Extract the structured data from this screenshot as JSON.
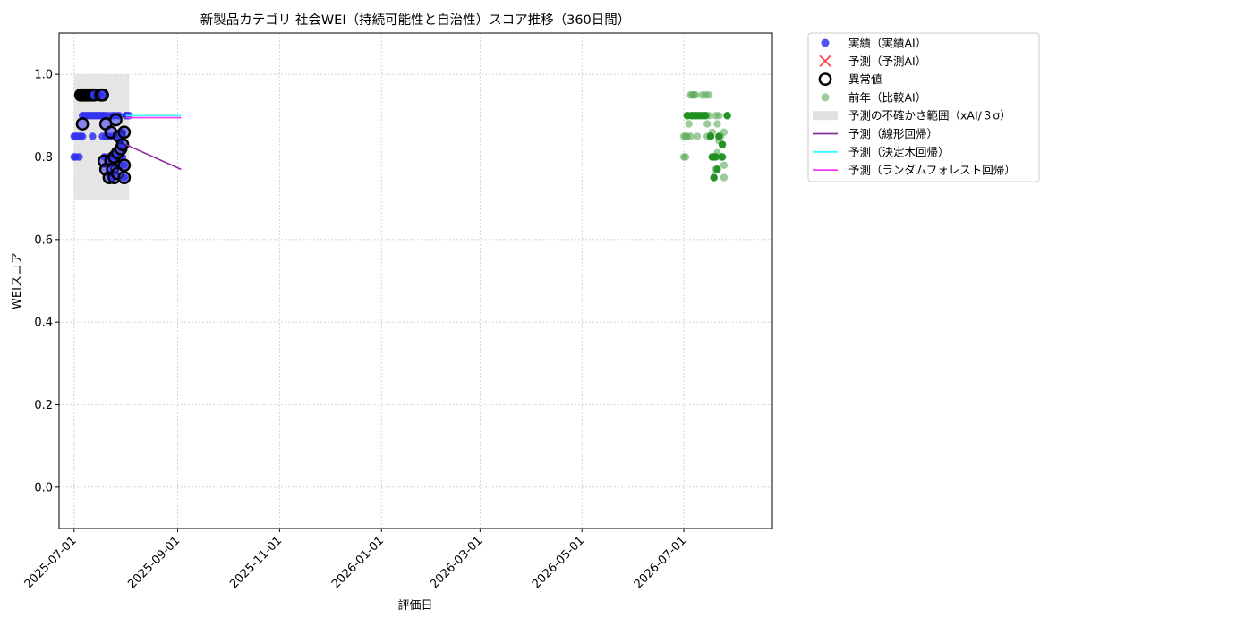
{
  "chart_data": {
    "type": "scatter",
    "title": "新製品カテゴリ 社会WEI（持続可能性と自治性）スコア推移（360日間）",
    "xlabel": "評価日",
    "ylabel": "WEIスコア",
    "ylim": [
      -0.1,
      1.1
    ],
    "y_ticks": [
      0.0,
      0.2,
      0.4,
      0.6,
      0.8,
      1.0
    ],
    "y_tick_labels": [
      "0.0",
      "0.2",
      "0.4",
      "0.6",
      "0.8",
      "1.0"
    ],
    "xlim": [
      "2025-06-22",
      "2026-08-23"
    ],
    "x_ticks": [
      "2025-07-01",
      "2025-09-01",
      "2025-11-01",
      "2026-01-01",
      "2026-03-01",
      "2026-05-01",
      "2026-07-01"
    ],
    "grid": true,
    "legend_position": "outside-top-right",
    "legend": [
      {
        "label": "実績（実績AI）",
        "marker": "dot",
        "color": "#3333ee"
      },
      {
        "label": "予測（予測AI）",
        "marker": "x",
        "color": "#ff4444"
      },
      {
        "label": "異常値",
        "marker": "ring",
        "color": "#000000"
      },
      {
        "label": "前年（比較AI）",
        "marker": "dot-light",
        "color": "#5aaa5a"
      },
      {
        "label": "予測の不確かさ範囲（xAI/３σ）",
        "marker": "band",
        "color": "#e0e0e0"
      },
      {
        "label": "予測（線形回帰）",
        "marker": "line",
        "color": "#8b2b9b"
      },
      {
        "label": "予測（決定木回帰）",
        "marker": "line",
        "color": "#33ffff"
      },
      {
        "label": "予測（ランダムフォレスト回帰）",
        "marker": "line",
        "color": "#ff33ff"
      }
    ],
    "series": [
      {
        "name": "実績（実績AI）",
        "color": "#3333ee",
        "points": [
          [
            "2025-07-01",
            0.85
          ],
          [
            "2025-07-01",
            0.8
          ],
          [
            "2025-07-02",
            0.85
          ],
          [
            "2025-07-02",
            0.8
          ],
          [
            "2025-07-03",
            0.85
          ],
          [
            "2025-07-04",
            0.85
          ],
          [
            "2025-07-04",
            0.8
          ],
          [
            "2025-07-05",
            0.85
          ],
          [
            "2025-07-06",
            0.85
          ],
          [
            "2025-07-06",
            0.9
          ],
          [
            "2025-07-07",
            0.9
          ],
          [
            "2025-07-07",
            0.95
          ],
          [
            "2025-07-08",
            0.9
          ],
          [
            "2025-07-08",
            0.95
          ],
          [
            "2025-07-09",
            0.9
          ],
          [
            "2025-07-09",
            0.95
          ],
          [
            "2025-07-10",
            0.9
          ],
          [
            "2025-07-10",
            0.95
          ],
          [
            "2025-07-11",
            0.9
          ],
          [
            "2025-07-11",
            0.95
          ],
          [
            "2025-07-12",
            0.85
          ],
          [
            "2025-07-12",
            0.9
          ],
          [
            "2025-07-13",
            0.9
          ],
          [
            "2025-07-13",
            0.95
          ],
          [
            "2025-07-14",
            0.9
          ],
          [
            "2025-07-14",
            0.95
          ],
          [
            "2025-07-15",
            0.9
          ],
          [
            "2025-07-15",
            0.95
          ],
          [
            "2025-07-16",
            0.9
          ],
          [
            "2025-07-16",
            0.95
          ],
          [
            "2025-07-17",
            0.9
          ],
          [
            "2025-07-17",
            0.95
          ],
          [
            "2025-07-18",
            0.9
          ],
          [
            "2025-07-18",
            0.85
          ],
          [
            "2025-07-19",
            0.9
          ],
          [
            "2025-07-19",
            0.8
          ],
          [
            "2025-07-20",
            0.9
          ],
          [
            "2025-07-20",
            0.85
          ],
          [
            "2025-07-21",
            0.85
          ],
          [
            "2025-07-21",
            0.8
          ],
          [
            "2025-07-22",
            0.85
          ],
          [
            "2025-07-22",
            0.9
          ],
          [
            "2025-07-23",
            0.8
          ],
          [
            "2025-07-23",
            0.75
          ],
          [
            "2025-07-24",
            0.85
          ],
          [
            "2025-07-24",
            0.9
          ],
          [
            "2025-07-25",
            0.8
          ],
          [
            "2025-07-25",
            0.9
          ],
          [
            "2025-07-26",
            0.85
          ],
          [
            "2025-07-26",
            0.78
          ],
          [
            "2025-07-27",
            0.9
          ],
          [
            "2025-07-27",
            0.8
          ],
          [
            "2025-07-28",
            0.9
          ],
          [
            "2025-07-28",
            0.85
          ],
          [
            "2025-07-29",
            0.83
          ],
          [
            "2025-07-29",
            0.78
          ],
          [
            "2025-07-30",
            0.8
          ],
          [
            "2025-07-30",
            0.86
          ],
          [
            "2025-07-31",
            0.75
          ],
          [
            "2025-07-31",
            0.78
          ],
          [
            "2025-08-01",
            0.9
          ],
          [
            "2025-08-01",
            0.9
          ],
          [
            "2025-08-02",
            0.9
          ],
          [
            "2025-08-03",
            0.9
          ]
        ]
      },
      {
        "name": "異常値",
        "color": "#000000",
        "points": [
          [
            "2025-07-05",
            0.95
          ],
          [
            "2025-07-06",
            0.95
          ],
          [
            "2025-07-07",
            0.95
          ],
          [
            "2025-07-08",
            0.95
          ],
          [
            "2025-07-09",
            0.95
          ],
          [
            "2025-07-10",
            0.95
          ],
          [
            "2025-07-11",
            0.95
          ],
          [
            "2025-07-12",
            0.95
          ],
          [
            "2025-07-13",
            0.95
          ],
          [
            "2025-07-17",
            0.95
          ],
          [
            "2025-07-18",
            0.95
          ],
          [
            "2025-07-06",
            0.88
          ],
          [
            "2025-07-20",
            0.88
          ],
          [
            "2025-07-19",
            0.79
          ],
          [
            "2025-07-20",
            0.77
          ],
          [
            "2025-07-22",
            0.75
          ],
          [
            "2025-07-23",
            0.79
          ],
          [
            "2025-07-23",
            0.86
          ],
          [
            "2025-07-24",
            0.77
          ],
          [
            "2025-07-25",
            0.8
          ],
          [
            "2025-07-25",
            0.75
          ],
          [
            "2025-07-26",
            0.89
          ],
          [
            "2025-07-27",
            0.81
          ],
          [
            "2025-07-27",
            0.76
          ],
          [
            "2025-07-28",
            0.85
          ],
          [
            "2025-07-29",
            0.82
          ],
          [
            "2025-07-30",
            0.83
          ],
          [
            "2025-07-31",
            0.86
          ],
          [
            "2025-07-31",
            0.78
          ],
          [
            "2025-07-31",
            0.75
          ]
        ]
      },
      {
        "name": "前年（比較AI）",
        "color": "#5aaa5a",
        "points": [
          [
            "2026-07-01",
            0.85
          ],
          [
            "2026-07-01",
            0.8
          ],
          [
            "2026-07-02",
            0.85
          ],
          [
            "2026-07-02",
            0.8
          ],
          [
            "2026-07-03",
            0.85
          ],
          [
            "2026-07-03",
            0.9
          ],
          [
            "2026-07-04",
            0.9
          ],
          [
            "2026-07-04",
            0.88
          ],
          [
            "2026-07-05",
            0.9
          ],
          [
            "2026-07-05",
            0.85
          ],
          [
            "2026-07-05",
            0.95
          ],
          [
            "2026-07-06",
            0.95
          ],
          [
            "2026-07-06",
            0.9
          ],
          [
            "2026-07-07",
            0.95
          ],
          [
            "2026-07-07",
            0.9
          ],
          [
            "2026-07-08",
            0.95
          ],
          [
            "2026-07-08",
            0.9
          ],
          [
            "2026-07-09",
            0.85
          ],
          [
            "2026-07-09",
            0.9
          ],
          [
            "2026-07-10",
            0.9
          ],
          [
            "2026-07-11",
            0.9
          ],
          [
            "2026-07-12",
            0.95
          ],
          [
            "2026-07-13",
            0.9
          ],
          [
            "2026-07-14",
            0.95
          ],
          [
            "2026-07-14",
            0.9
          ],
          [
            "2026-07-15",
            0.88
          ],
          [
            "2026-07-15",
            0.85
          ],
          [
            "2026-07-16",
            0.95
          ],
          [
            "2026-07-16",
            0.9
          ],
          [
            "2026-07-17",
            0.85
          ],
          [
            "2026-07-18",
            0.86
          ],
          [
            "2026-07-18",
            0.8
          ],
          [
            "2026-07-19",
            0.8
          ],
          [
            "2026-07-19",
            0.75
          ],
          [
            "2026-07-20",
            0.9
          ],
          [
            "2026-07-20",
            0.77
          ],
          [
            "2026-07-21",
            0.88
          ],
          [
            "2026-07-21",
            0.81
          ],
          [
            "2026-07-22",
            0.84
          ],
          [
            "2026-07-22",
            0.9
          ],
          [
            "2026-07-23",
            0.85
          ],
          [
            "2026-07-23",
            0.8
          ],
          [
            "2026-07-24",
            0.83
          ],
          [
            "2026-07-25",
            0.86
          ],
          [
            "2026-07-25",
            0.78
          ],
          [
            "2026-07-25",
            0.75
          ],
          [
            "2026-07-27",
            0.9
          ]
        ]
      },
      {
        "name": "前年（比較AI） – 濃色点",
        "color": "#1f8f1f",
        "points": [
          [
            "2026-07-03",
            0.9
          ],
          [
            "2026-07-06",
            0.9
          ],
          [
            "2026-07-08",
            0.9
          ],
          [
            "2026-07-10",
            0.9
          ],
          [
            "2026-07-12",
            0.9
          ],
          [
            "2026-07-14",
            0.9
          ],
          [
            "2026-07-17",
            0.85
          ],
          [
            "2026-07-18",
            0.8
          ],
          [
            "2026-07-19",
            0.75
          ],
          [
            "2026-07-20",
            0.8
          ],
          [
            "2026-07-21",
            0.77
          ],
          [
            "2026-07-22",
            0.85
          ],
          [
            "2026-07-24",
            0.83
          ],
          [
            "2026-07-24",
            0.8
          ],
          [
            "2026-07-27",
            0.9
          ]
        ]
      }
    ],
    "uncertainty_band": {
      "x0": "2025-07-01",
      "x1": "2025-08-03",
      "y0": 0.695,
      "y1": 1.0
    },
    "forecast_lines": [
      {
        "name": "予測（線形回帰）",
        "color": "#8b2b9b",
        "points": [
          [
            "2025-08-01",
            0.83
          ],
          [
            "2025-09-03",
            0.77
          ]
        ]
      },
      {
        "name": "予測（決定木回帰）",
        "color": "#33ffff",
        "points": [
          [
            "2025-08-01",
            0.9
          ],
          [
            "2025-09-03",
            0.9
          ]
        ]
      },
      {
        "name": "予測（ランダムフォレスト回帰）",
        "color": "#ff33ff",
        "points": [
          [
            "2025-08-01",
            0.895
          ],
          [
            "2025-09-03",
            0.895
          ]
        ]
      }
    ]
  }
}
